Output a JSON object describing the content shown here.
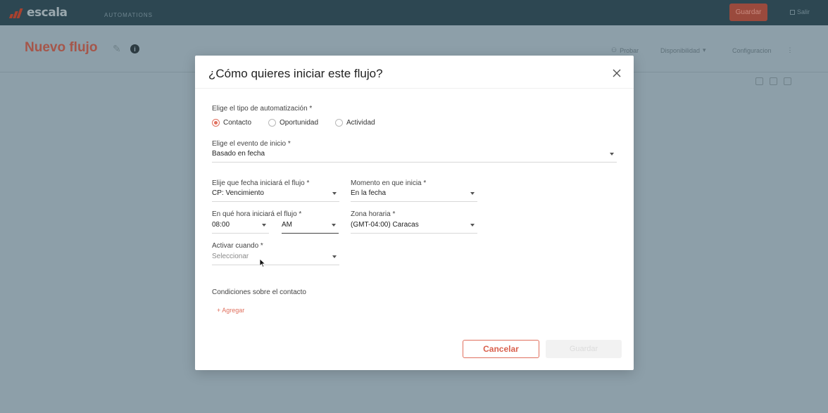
{
  "app": {
    "logo_text": "escala",
    "nav_label": "AUTOMATIONS",
    "top_button": "Guardar",
    "exit_label": "Salir"
  },
  "page": {
    "title": "Nuevo flujo",
    "actions": [
      "Probar",
      "Disponibilidad",
      "Configuracion"
    ]
  },
  "modal": {
    "title": "¿Cómo quieres iniciar este flujo?",
    "automation_type": {
      "label": "Elige el tipo de automatización *",
      "options": [
        "Contacto",
        "Oportunidad",
        "Actividad"
      ],
      "selected": "Contacto"
    },
    "start_event": {
      "label": "Elige el evento de inicio *",
      "value": "Basado en fecha"
    },
    "date_field": {
      "label": "Elije que fecha iniciará el flujo *",
      "value": "CP: Vencimiento"
    },
    "moment": {
      "label": "Momento en que inicia *",
      "value": "En la fecha"
    },
    "start_time": {
      "label": "En qué hora iniciará el flujo *",
      "hour": "08:00",
      "period": "AM"
    },
    "timezone": {
      "label": "Zona horaria *",
      "value": "(GMT-04:00) Caracas"
    },
    "activate_when": {
      "label": "Activar cuando *",
      "placeholder": "Seleccionar"
    },
    "conditions": {
      "label": "Condiciones sobre el contacto",
      "add_link": "+ Agregar"
    },
    "buttons": {
      "cancel": "Cancelar",
      "save": "Guardar"
    }
  },
  "colors": {
    "accent": "#e0705e",
    "overlay": "#8d9fa9",
    "topbar": "#2d4752"
  }
}
